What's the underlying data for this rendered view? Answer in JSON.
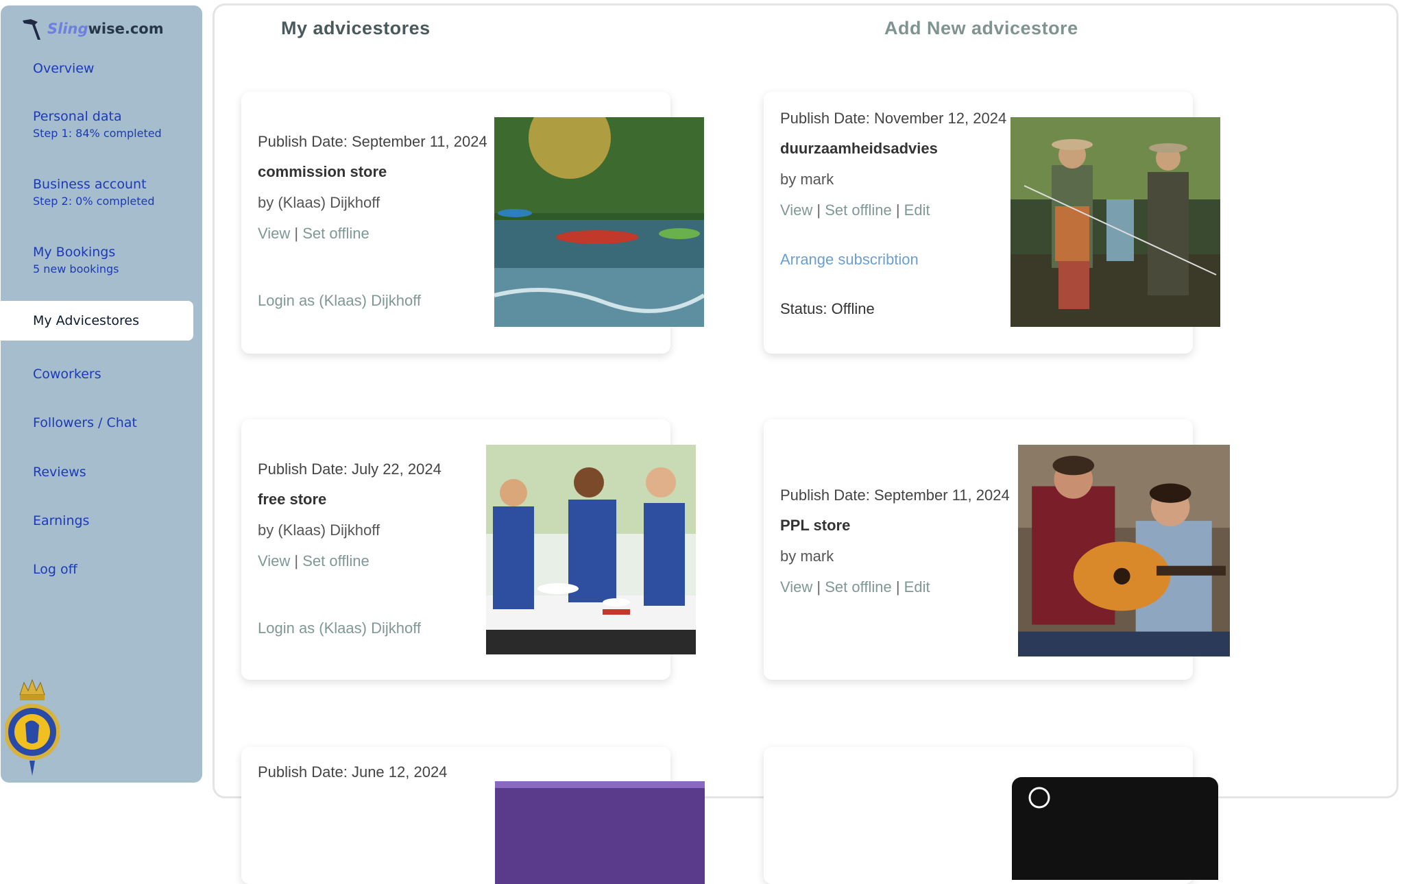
{
  "logo": {
    "sling": "Sling",
    "wise": "wise.com"
  },
  "sidebar": {
    "items": [
      {
        "label": "Overview"
      },
      {
        "label": "Personal data",
        "sub": "Step 1: 84% completed"
      },
      {
        "label": "Business account",
        "sub": "Step 2: 0% completed"
      },
      {
        "label": "My Bookings",
        "sub": "5 new bookings"
      },
      {
        "label": "My Advicestores"
      },
      {
        "label": "Coworkers"
      },
      {
        "label": "Followers / Chat"
      },
      {
        "label": "Reviews"
      },
      {
        "label": "Earnings"
      },
      {
        "label": "Log off"
      }
    ],
    "active_index": 4
  },
  "main": {
    "heading_my": "My advicestores",
    "heading_add": "Add New advicestore"
  },
  "cards": [
    {
      "date": "Publish Date: September 11, 2024",
      "title": "commission store",
      "by": "by (Klaas) Dijkhoff",
      "view": "View",
      "sep1": " | ",
      "offline": "Set offline",
      "login": "Login as (Klaas) Dijkhoff",
      "image_icon": "kayak-river-photo"
    },
    {
      "date": "Publish Date: November 12, 2024",
      "title": "duurzaamheidsadvies",
      "by": "by mark",
      "view": "View",
      "sep1": " | ",
      "offline": "Set offline",
      "sep2": " | ",
      "edit": "Edit",
      "arrange": "Arrange subscribtion",
      "status": "Status: Offline",
      "image_icon": "fishing-river-photo"
    },
    {
      "date": "Publish Date: July 22, 2024",
      "title": "free store",
      "by": "by (Klaas) Dijkhoff",
      "view": "View",
      "sep1": " | ",
      "offline": "Set offline",
      "login": "Login as (Klaas) Dijkhoff",
      "image_icon": "cooking-class-photo"
    },
    {
      "date": "Publish Date: September 11, 2024",
      "title": "PPL store",
      "by": "by mark",
      "view": "View",
      "sep1": " | ",
      "offline": "Set offline",
      "sep2": " | ",
      "edit": "Edit",
      "image_icon": "guitar-lesson-photo"
    },
    {
      "date": "Publish Date: June 12, 2024",
      "image_icon": "store-banner-photo"
    },
    {
      "image_icon": "dark-banner-photo"
    }
  ],
  "colors": {
    "sidebar_bg": "#a5bdcd",
    "nav_text": "#1c3ab8",
    "link": "#7f9895",
    "arrange_link": "#6a9fcf",
    "heading_dark": "#4a5a5c",
    "heading_light": "#7f9390"
  }
}
